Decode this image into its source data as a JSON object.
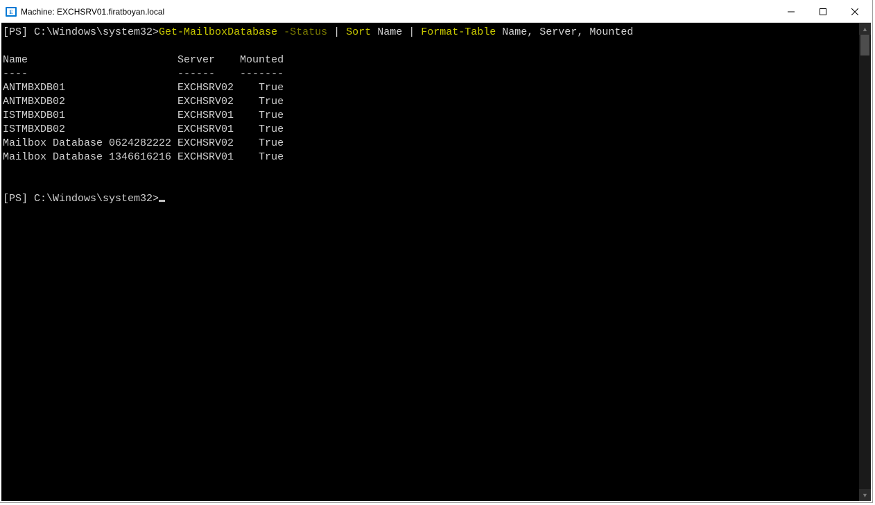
{
  "window": {
    "title": "Machine: EXCHSRV01.firatboyan.local"
  },
  "prompt": {
    "tag": "[PS]",
    "path": "C:\\Windows\\system32>"
  },
  "command": {
    "cmdlet": "Get-MailboxDatabase",
    "param": "-Status",
    "pipe1": "|",
    "sortCmd": "Sort",
    "sortArg": "Name",
    "pipe2": "|",
    "ftCmd": "Format-Table",
    "ftArgs": "Name, Server, Mounted"
  },
  "headers": {
    "name": "Name",
    "server": "Server",
    "mounted": "Mounted",
    "sepName": "----",
    "sepServer": "------",
    "sepMounted": "-------"
  },
  "rows": [
    {
      "name": "ANTMBXDB01",
      "server": "EXCHSRV02",
      "mounted": "True"
    },
    {
      "name": "ANTMBXDB02",
      "server": "EXCHSRV02",
      "mounted": "True"
    },
    {
      "name": "ISTMBXDB01",
      "server": "EXCHSRV01",
      "mounted": "True"
    },
    {
      "name": "ISTMBXDB02",
      "server": "EXCHSRV01",
      "mounted": "True"
    },
    {
      "name": "Mailbox Database 0624282222",
      "server": "EXCHSRV02",
      "mounted": "True"
    },
    {
      "name": "Mailbox Database 1346616216",
      "server": "EXCHSRV01",
      "mounted": "True"
    }
  ]
}
